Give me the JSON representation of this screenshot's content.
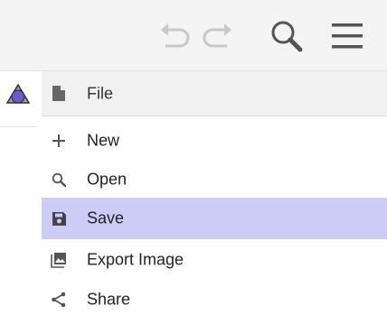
{
  "toolbar": {
    "undo_icon": "undo-icon",
    "redo_icon": "redo-icon",
    "search_icon": "search-icon",
    "menu_icon": "hamburger-menu-icon"
  },
  "side": {
    "tool_icon": "geometry-tool-icon"
  },
  "menu": {
    "header": {
      "label": "File",
      "icon": "file-icon"
    },
    "items": [
      {
        "label": "New",
        "icon": "plus-icon"
      },
      {
        "label": "Open",
        "icon": "search-icon"
      },
      {
        "label": "Save",
        "icon": "save-icon"
      },
      {
        "label": "Export Image",
        "icon": "image-icon"
      },
      {
        "label": "Share",
        "icon": "share-icon"
      }
    ],
    "selected_label": "Save"
  },
  "colors": {
    "selected_bg": "#cdccf7",
    "toolbar_icon_disabled": "#c8c8c8",
    "toolbar_icon": "#555555",
    "menu_icon": "#666666"
  }
}
